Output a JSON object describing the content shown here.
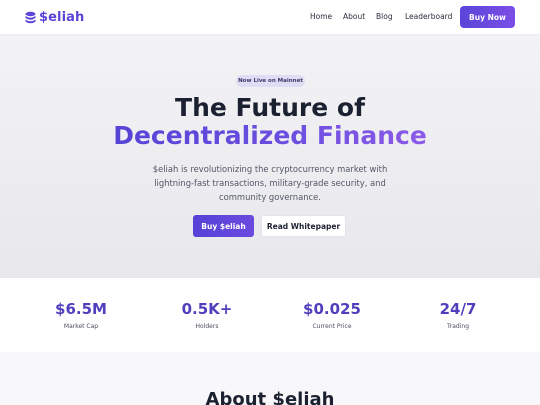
{
  "brand": {
    "name": "$eliah",
    "accent_color": "#5b45d8",
    "icon": "coin-stack-icon"
  },
  "nav": {
    "links": [
      "Home",
      "About",
      "Blog",
      "Leaderboard"
    ],
    "cta_label": "Buy Now"
  },
  "hero": {
    "badge": "Now Live on Mainnet",
    "title_line1": "The Future of",
    "title_line2": "Decentralized Finance",
    "description": "$eliah is revolutionizing the cryptocurrency market with lightning-fast transactions, military-grade security, and community governance.",
    "primary_button": "Buy $eliah",
    "secondary_button": "Read Whitepaper"
  },
  "stats": [
    {
      "value": "$6.5M",
      "label": "Market Cap"
    },
    {
      "value": "0.5K+",
      "label": "Holders"
    },
    {
      "value": "$0.025",
      "label": "Current Price"
    },
    {
      "value": "24/7",
      "label": "Trading"
    }
  ],
  "about": {
    "title": "About $eliah"
  }
}
